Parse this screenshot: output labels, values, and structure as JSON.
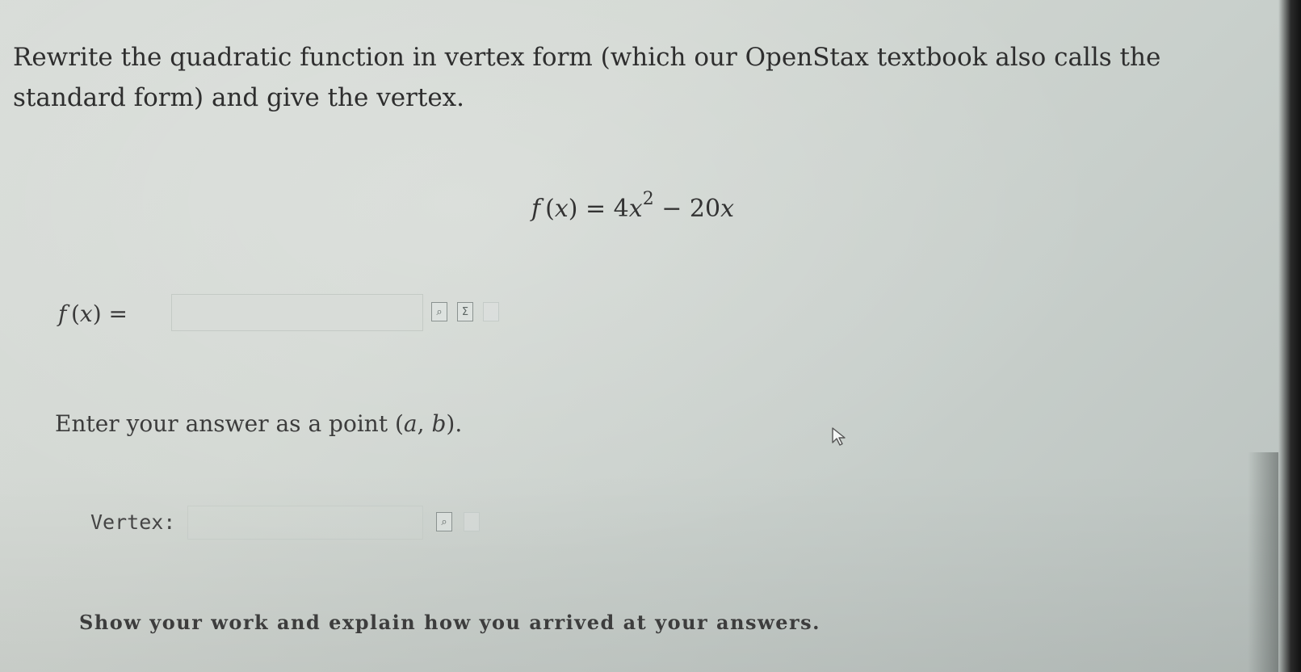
{
  "question": {
    "prompt": "Rewrite the quadratic function in vertex form (which our OpenStax textbook also calls the standard form) and give the vertex."
  },
  "equation": {
    "lhs_fn": "f",
    "lhs_var": "x",
    "equals": "=",
    "coef": "4",
    "var": "x",
    "exp": "2",
    "minus": "−",
    "term2_coef": "20",
    "term2_var": "x"
  },
  "answer_fx": {
    "label_fn": "f",
    "label_var": "x",
    "label_equals": "=",
    "value": "",
    "placeholder": "",
    "icons": [
      "preview-icon",
      "sigma-icon",
      "blank-icon"
    ]
  },
  "point_instruction": {
    "prefix": "Enter your answer as a point ",
    "a": "a",
    "b": "b",
    "suffix": "."
  },
  "vertex": {
    "label": "Vertex:",
    "value": "",
    "placeholder": "",
    "icons": [
      "preview-icon",
      "blank-icon"
    ]
  },
  "show_work": {
    "text": "Show your work and explain how you arrived at your answers."
  },
  "tool_glyphs": {
    "preview": "⌕",
    "sigma": "Σ",
    "blank": ""
  }
}
